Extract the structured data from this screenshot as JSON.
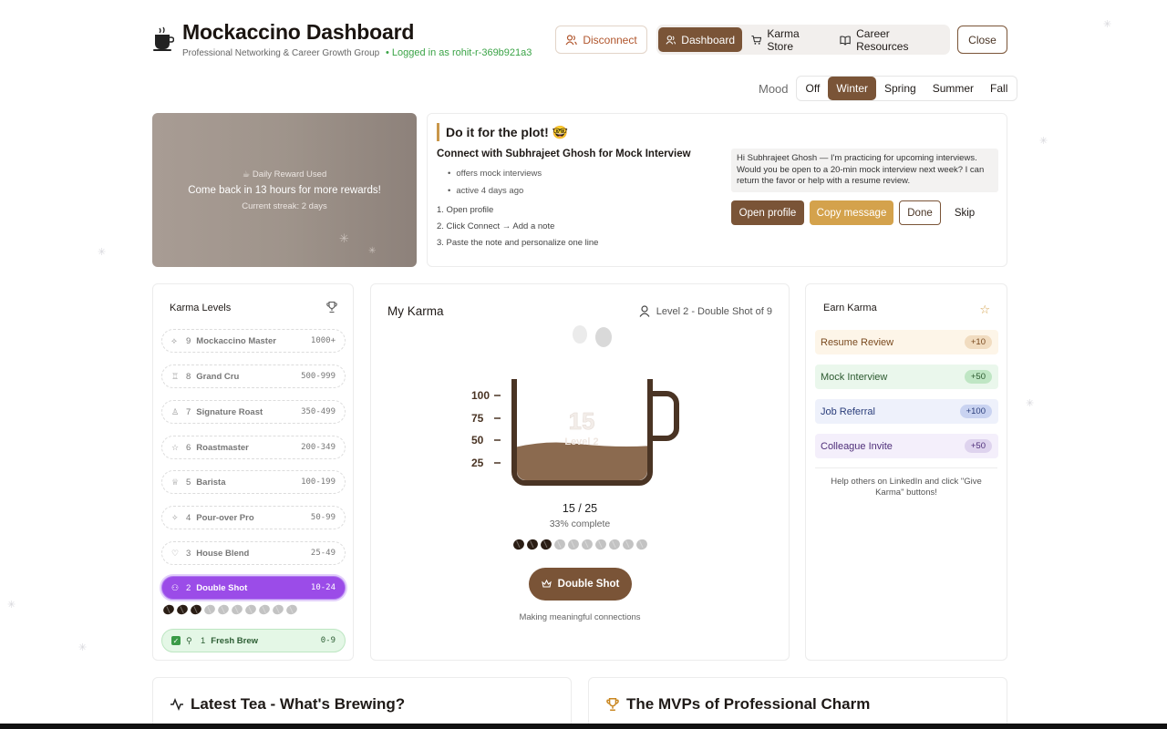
{
  "header": {
    "title": "Mockaccino Dashboard",
    "subtitle": "Professional Networking & Career Growth Group",
    "logged_in": "• Logged in as rohit-r-369b921a3",
    "disconnect": "Disconnect",
    "nav": {
      "dashboard": "Dashboard",
      "karma_store": "Karma Store",
      "career_resources": "Career Resources"
    },
    "close": "Close"
  },
  "mood": {
    "label": "Mood",
    "options": [
      "Off",
      "Winter",
      "Spring",
      "Summer",
      "Fall"
    ],
    "selected": "Winter"
  },
  "reward": {
    "status": "☕ Daily Reward Used",
    "message": "Come back in 13 hours for more rewards!",
    "streak": "Current streak: 2 days"
  },
  "plot": {
    "title": "Do it for the plot! 🤓",
    "subtitle": "Connect with Subhrajeet Ghosh for Mock Interview",
    "bullets": [
      "offers mock interviews",
      "active 4 days ago"
    ],
    "steps": [
      "1. Open profile",
      "2. Click Connect → Add a note",
      "3. Paste the note and personalize one line"
    ],
    "message": "Hi Subhrajeet Ghosh — I'm practicing for upcoming interviews. Would you be open to a 20-min mock interview next week? I can return the favor or help with a resume review.",
    "buttons": {
      "open_profile": "Open profile",
      "copy_message": "Copy message",
      "done": "Done",
      "skip": "Skip"
    }
  },
  "karma_levels": {
    "title": "Karma Levels",
    "levels": [
      {
        "num": "9",
        "name": "Mockaccino Master",
        "range": "1000+",
        "icon": "⟡"
      },
      {
        "num": "8",
        "name": "Grand Cru",
        "range": "500-999",
        "icon": "♖"
      },
      {
        "num": "7",
        "name": "Signature Roast",
        "range": "350-499",
        "icon": "♙"
      },
      {
        "num": "6",
        "name": "Roastmaster",
        "range": "200-349",
        "icon": "☆"
      },
      {
        "num": "5",
        "name": "Barista",
        "range": "100-199",
        "icon": "♕"
      },
      {
        "num": "4",
        "name": "Pour-over Pro",
        "range": "50-99",
        "icon": "✧"
      },
      {
        "num": "3",
        "name": "House Blend",
        "range": "25-49",
        "icon": "♡"
      },
      {
        "num": "2",
        "name": "Double Shot",
        "range": "10-24",
        "icon": "⚇"
      },
      {
        "num": "1",
        "name": "Fresh Brew",
        "range": "0-9",
        "icon": "⚲"
      }
    ],
    "progress_beans_filled": 3,
    "progress_beans_total": 10
  },
  "my_karma": {
    "title": "My Karma",
    "level_text": "Level 2 - Double Shot of 9",
    "cup_value": "15",
    "cup_level": "Level 2",
    "ticks": [
      "100",
      "75",
      "50",
      "25"
    ],
    "fill_fraction": 0.33,
    "count": "15 / 25",
    "percent": "33% complete",
    "beans_filled": 3,
    "beans_total": 10,
    "badge": "Double Shot",
    "footer": "Making meaningful connections"
  },
  "earn_karma": {
    "title": "Earn Karma",
    "items": [
      {
        "label": "Resume Review",
        "points": "+10"
      },
      {
        "label": "Mock Interview",
        "points": "+50"
      },
      {
        "label": "Job Referral",
        "points": "+100"
      },
      {
        "label": "Colleague Invite",
        "points": "+50"
      }
    ],
    "note": "Help others on LinkedIn and click \"Give Karma\" buttons!"
  },
  "bottom": {
    "latest_tea": "Latest Tea - What's Brewing?",
    "mvps": "The MVPs of Professional Charm"
  },
  "colors": {
    "brand_brown": "#7a5437",
    "accent_gold": "#d4a24c",
    "current_level_purple": "#9b4ce8",
    "success_green": "#3a9a47"
  }
}
